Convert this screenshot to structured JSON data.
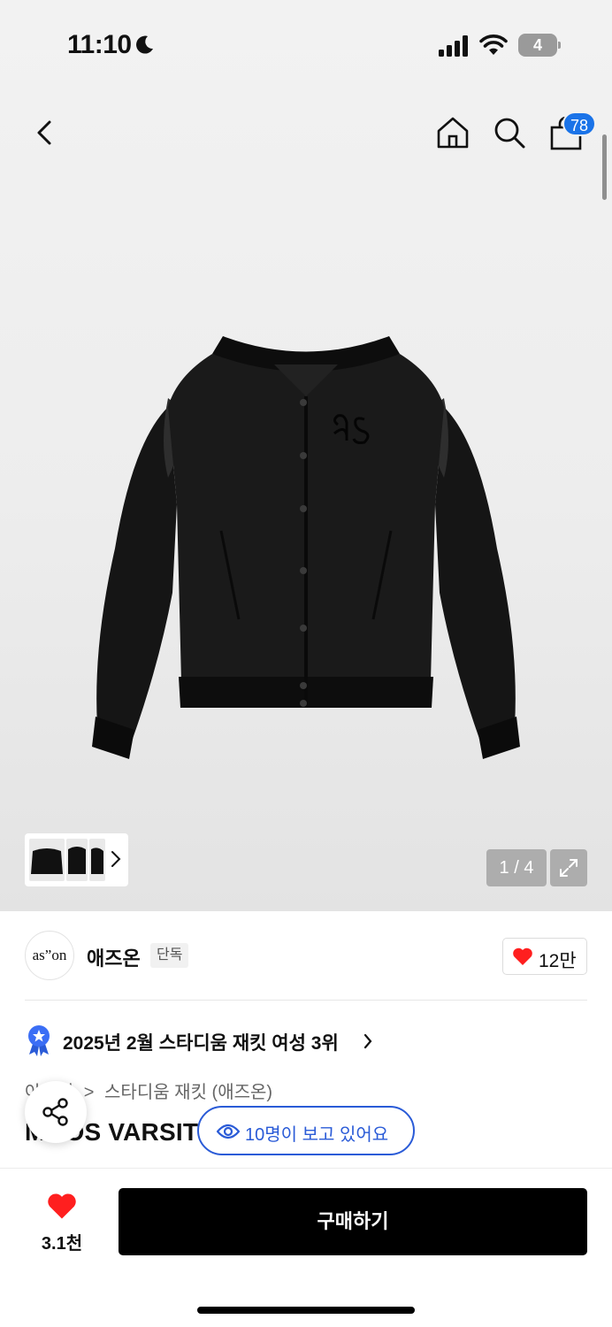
{
  "status_bar": {
    "time": "11:10",
    "battery": "4"
  },
  "nav": {
    "cart_count": "78"
  },
  "gallery": {
    "counter": "1 / 4",
    "thumbnail_count": 3
  },
  "brand": {
    "logo_text": "as”on",
    "name": "애즈온",
    "tag": "단독",
    "likes": "12만"
  },
  "ranking": {
    "text": "2025년 2월 스타디움 재킷 여성 3위"
  },
  "breadcrumb": {
    "parent": "아우터",
    "separator": ">",
    "current": "스타디움 재킷 (애즈온)"
  },
  "product": {
    "title": "MOOS VARSITY JACKET"
  },
  "viewers": {
    "text": "10명이 보고 있어요"
  },
  "bottom_bar": {
    "wish_count": "3.1천",
    "buy_label": "구매하기"
  },
  "colors": {
    "accent_blue": "#2a5bd7",
    "badge_blue": "#1a73e8",
    "heart_red": "#ff1f1f",
    "buy_button": "#000000"
  },
  "icons": [
    "moon-icon",
    "signal-icon",
    "wifi-icon",
    "battery-icon",
    "back-icon",
    "home-icon",
    "search-icon",
    "bag-icon",
    "expand-icon",
    "heart-icon",
    "rank-medal-icon",
    "share-icon",
    "eye-icon"
  ]
}
